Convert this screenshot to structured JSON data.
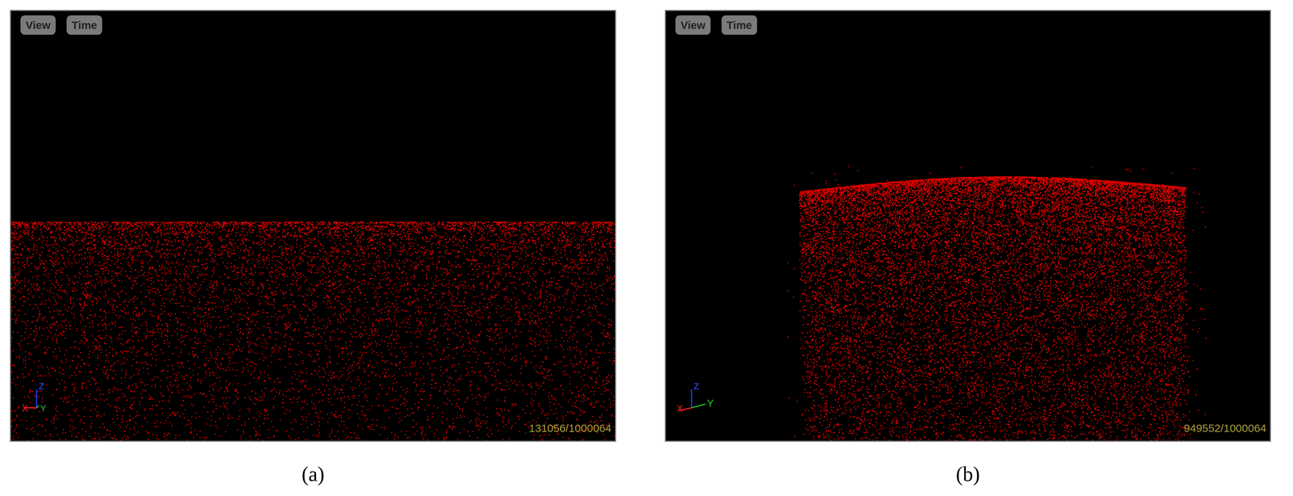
{
  "panels": [
    {
      "kind": "slab",
      "buttons": [
        "View",
        "Time"
      ],
      "count": "131056/1000064",
      "axes": {
        "x": "X",
        "y": "Y",
        "z": "Z"
      },
      "caption": "(a)"
    },
    {
      "kind": "block",
      "buttons": [
        "View",
        "Time"
      ],
      "count": "949552/1000064",
      "axes": {
        "x": "X",
        "y": "Y",
        "z": "Z"
      },
      "caption": "(b)"
    }
  ]
}
